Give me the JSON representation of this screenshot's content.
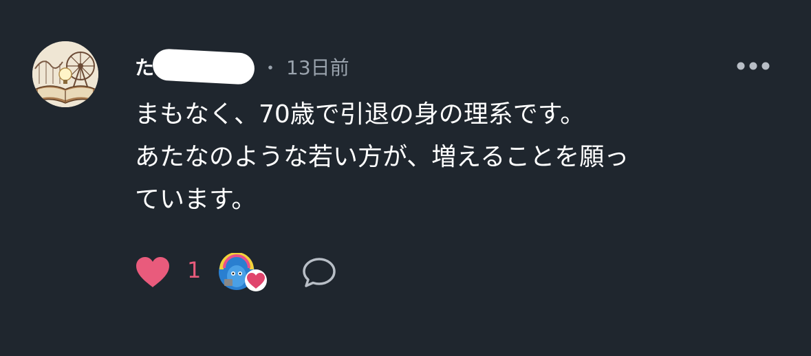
{
  "comment": {
    "author": {
      "name_visible": "た",
      "avatar_icon": "library-ferris-wheel-avatar"
    },
    "separator": "・",
    "time_ago": "13日前",
    "more_icon": "more-horizontal-icon",
    "body_lines": [
      "まもなく、70歳で引退の身の理系です。",
      "あたなのような若い方が、増えることを願っ",
      "ています。"
    ],
    "actions": {
      "like_icon": "heart-icon",
      "like_count": "1",
      "like_color": "#e95b7c",
      "reactor_icon": "creator-heart-avatar",
      "comment_icon": "comment-bubble-icon"
    }
  },
  "colors": {
    "background": "#1f262e",
    "text": "#ffffff",
    "muted": "#9aa3ad",
    "accent": "#e95b7c"
  }
}
